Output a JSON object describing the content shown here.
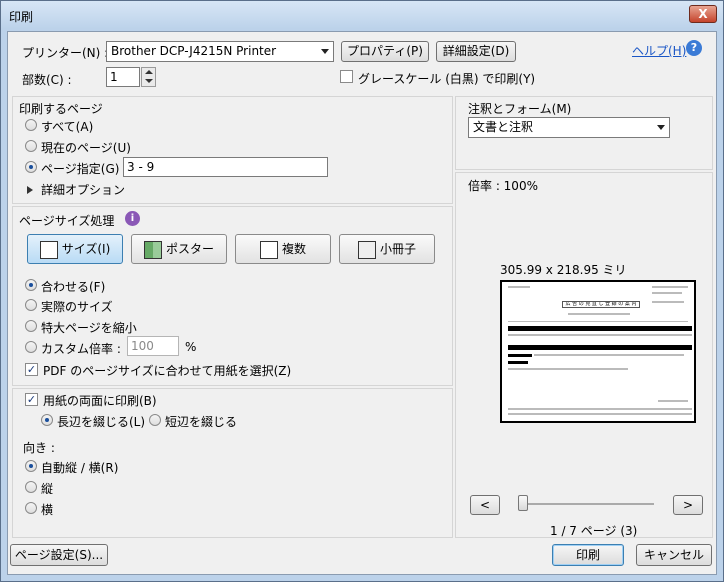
{
  "window": {
    "title": "印刷",
    "close_label": "X"
  },
  "printer": {
    "label": "プリンター(N) :",
    "selected": "Brother DCP-J4215N Printer",
    "properties_button": "プロパティ(P)",
    "advanced_button": "詳細設定(D)",
    "help_link": "ヘルプ(H)"
  },
  "copies": {
    "label": "部数(C) :",
    "value": "1"
  },
  "grayscale": {
    "label": "グレースケール (白黒) で印刷(Y)",
    "checked": false
  },
  "pages": {
    "heading": "印刷するページ",
    "all": "すべて(A)",
    "current": "現在のページ(U)",
    "range": "ページ指定(G)",
    "range_value": "3 - 9",
    "more_options": "詳細オプション"
  },
  "annotations": {
    "heading": "注釈とフォーム(M)",
    "selected": "文書と注釈"
  },
  "scale_readout": "倍率 : 100%",
  "sizing": {
    "heading": "ページサイズ処理",
    "buttons": {
      "size": "サイズ(I)",
      "poster": "ポスター",
      "multiple": "複数",
      "booklet": "小冊子"
    },
    "fit": "合わせる(F)",
    "actual": "実際のサイズ",
    "shrink": "特大ページを縮小",
    "custom": "カスタム倍率 :",
    "custom_value": "100",
    "custom_unit": "%",
    "choose_paper": "PDF のページサイズに合わせて用紙を選択(Z)"
  },
  "duplex": {
    "label": "用紙の両面に印刷(B)",
    "long_edge": "長辺を綴じる(L)",
    "short_edge": "短辺を綴じる"
  },
  "orientation": {
    "heading": "向き :",
    "auto": "自動縦 / 横(R)",
    "portrait": "縦",
    "landscape": "横"
  },
  "preview": {
    "dimensions": "305.99 x 218.95 ミリ",
    "page_indicator": "1 / 7 ページ (3)",
    "prev": "<",
    "next": ">",
    "slider_fraction": 0.0,
    "doc_title": "広 告 の 見 直 し 登 録 の 案 内"
  },
  "footer": {
    "page_setup": "ページ設定(S)...",
    "print": "印刷",
    "cancel": "キャンセル"
  }
}
